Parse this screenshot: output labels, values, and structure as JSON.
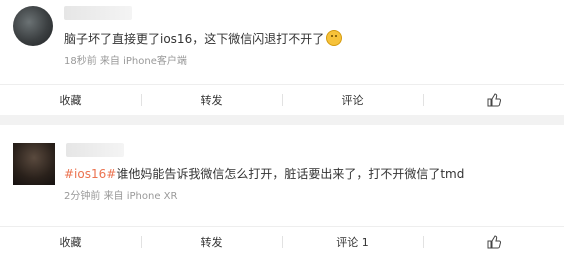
{
  "comments": [
    {
      "username": "",
      "text": "脑子坏了直接更了ios16，这下微信闪退打不开了",
      "emoji": "grinning-face-emoji",
      "time": "18秒前",
      "source": "来自 iPhone客户端",
      "actions": {
        "favorite": "收藏",
        "repost": "转发",
        "comment": "评论",
        "like_icon": "thumbs-up-icon"
      }
    },
    {
      "username": "",
      "topic": "#ios16#",
      "text": "谁他妈能告诉我微信怎么打开，脏话要出来了，打不开微信了tmd",
      "time": "2分钟前",
      "source": "来自 iPhone XR",
      "actions": {
        "favorite": "收藏",
        "repost": "转发",
        "comment": "评论 1",
        "like_icon": "thumbs-up-icon"
      }
    }
  ],
  "colors": {
    "topic": "#eb7350",
    "meta": "#999999",
    "background": "#f2f2f2"
  }
}
